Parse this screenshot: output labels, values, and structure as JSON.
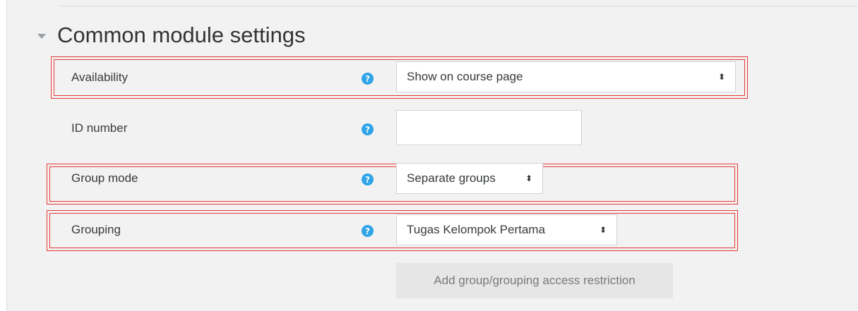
{
  "section": {
    "title": "Common module settings",
    "collapse_icon": "triangle-down-icon"
  },
  "fields": {
    "availability": {
      "label": "Availability",
      "value": "Show on course page"
    },
    "id_number": {
      "label": "ID number",
      "value": ""
    },
    "group_mode": {
      "label": "Group mode",
      "value": "Separate groups"
    },
    "grouping": {
      "label": "Grouping",
      "value": "Tugas Kelompok Pertama"
    }
  },
  "help_icon_glyph": "?",
  "select_caret_glyph": "⬍",
  "actions": {
    "add_restriction_label": "Add group/grouping access restriction"
  },
  "colors": {
    "help_icon": "#2fa4e7",
    "highlight": "#e53935",
    "panel_bg": "#f2f2f2"
  }
}
